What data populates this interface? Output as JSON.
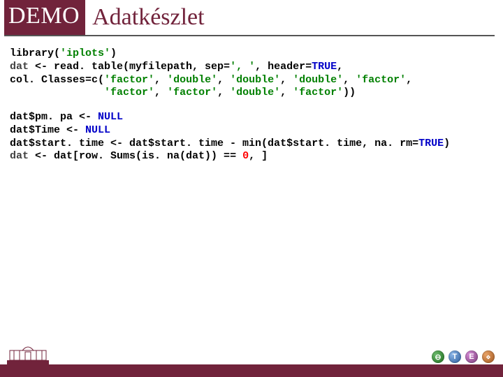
{
  "title": {
    "badge": "DEMO",
    "text": "Adatkészlet"
  },
  "code": {
    "l1a": "library(",
    "l1b": "'iplots'",
    "l1c": ")",
    "l2a": "dat",
    "l2b": " <- read. table(myfilepath, sep=",
    "l2c": "', '",
    "l2d": ", header=",
    "l2e": "TRUE",
    "l2f": ",",
    "l3a": "col. Classes=c(",
    "l3b": "'factor'",
    "l3c": ", ",
    "l3d": "'double'",
    "l3e": ", ",
    "l3f": "'double'",
    "l3g": ", ",
    "l3h": "'double'",
    "l3i": ", ",
    "l3j": "'factor'",
    "l3k": ",",
    "l4a": "               ",
    "l4b": "'factor'",
    "l4c": ", ",
    "l4d": "'factor'",
    "l4e": ", ",
    "l4f": "'double'",
    "l4g": ", ",
    "l4h": "'factor'",
    "l4i": "))",
    "l5a": "dat$pm. pa <- ",
    "l5b": "NULL",
    "l6a": "dat$Time <- ",
    "l6b": "NULL",
    "l7a": "dat$start. time <- dat$start. time - min(dat$start. time, na. rm=",
    "l7b": "TRUE",
    "l7c": ")",
    "l8a": "dat",
    "l8b": " <- dat[row. Sums(is. na(dat)) == ",
    "l8c": "0",
    "l8d": ", ]"
  },
  "icons": {
    "a": "⊖",
    "b": "T",
    "c": "E",
    "d": "⋄"
  },
  "colors": {
    "brand": "#71233b",
    "string": "#008000",
    "keyword": "#0000c8",
    "number": "#ff0000"
  }
}
